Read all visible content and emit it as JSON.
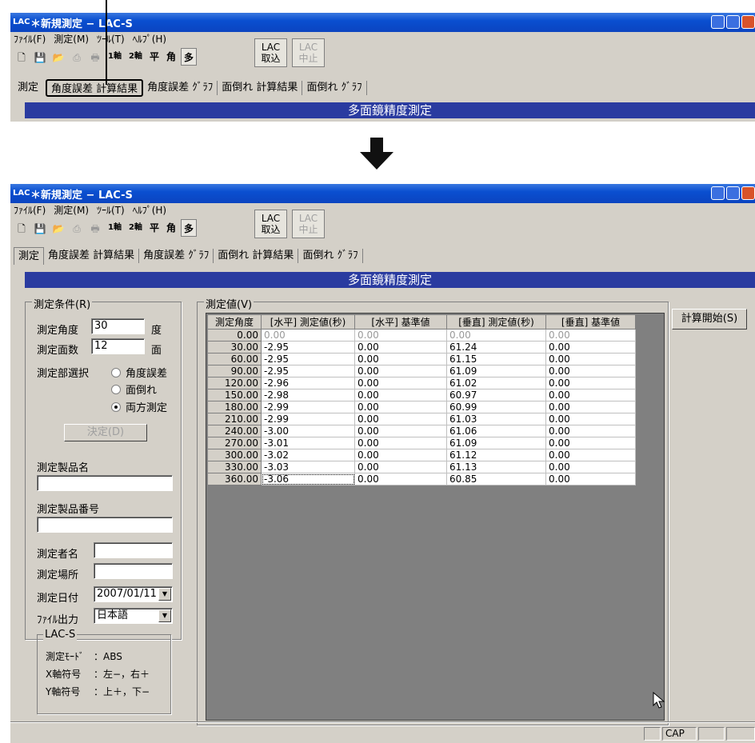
{
  "top_window": {
    "title": "＊新規測定 − LAC-S",
    "menu": [
      "ﾌｧｲﾙ(F)",
      "測定(M)",
      "ﾂｰﾙ(T)",
      "ﾍﾙﾌﾟ(H)"
    ],
    "toolbar": {
      "axis1": "1軸",
      "axis2": "2軸",
      "flat": "平",
      "angle": "角",
      "multi": "多"
    },
    "lac_import": "LAC\n取込",
    "lac_stop": "LAC\n中止",
    "tabs": [
      "測定",
      "角度誤差 計算結果",
      "角度誤差 ｸﾞﾗﾌ",
      "面倒れ 計算結果",
      "面倒れ ｸﾞﾗﾌ"
    ],
    "active_tab_index": 1,
    "banner": "多面鏡精度測定"
  },
  "arrow_icon": "down-arrow",
  "main_window": {
    "title": "＊新規測定 − LAC-S",
    "app_icon": "LAC",
    "menu": [
      "ﾌｧｲﾙ(F)",
      "測定(M)",
      "ﾂｰﾙ(T)",
      "ﾍﾙﾌﾟ(H)"
    ],
    "toolbar": {
      "axis1": "1軸",
      "axis2": "2軸",
      "flat": "平",
      "angle": "角",
      "multi": "多"
    },
    "lac_import": "LAC\n取込",
    "lac_stop": "LAC\n中止",
    "tabs": [
      "測定",
      "角度誤差 計算結果",
      "角度誤差 ｸﾞﾗﾌ",
      "面倒れ 計算結果",
      "面倒れ ｸﾞﾗﾌ"
    ],
    "active_tab_index": 0,
    "banner": "多面鏡精度測定",
    "conditions": {
      "group_label": "測定条件(R)",
      "angle_label": "測定角度",
      "angle_value": "30",
      "angle_unit": "度",
      "faces_label": "測定面数",
      "faces_value": "12",
      "faces_unit": "面",
      "part_label": "測定部選択",
      "radio_options": [
        "角度誤差",
        "面倒れ",
        "両方測定"
      ],
      "selected_radio": 2,
      "decide_button": "決定(D)",
      "product_name_label": "測定製品名",
      "product_name_value": "",
      "product_number_label": "測定製品番号",
      "product_number_value": "",
      "operator_label": "測定者名",
      "operator_value": "",
      "place_label": "測定場所",
      "place_value": "",
      "date_label": "測定日付",
      "date_value": "2007/01/11",
      "file_output_label": "ﾌｧｲﾙ出力",
      "file_output_value": "日本語",
      "lacs": {
        "group_label": "LAC-S",
        "mode_label": "測定ﾓｰﾄﾞ",
        "mode_value": "：ABS",
        "x_label": "X軸符号",
        "x_value": "：左−，右＋",
        "y_label": "Y軸符号",
        "y_value": "：上＋，下−"
      }
    },
    "values": {
      "group_label": "測定値(V)",
      "columns": [
        "測定角度",
        "[水平] 測定値(秒)",
        "[水平] 基準値",
        "[垂直] 測定値(秒)",
        "[垂直] 基準値"
      ],
      "rows": [
        [
          "0.00",
          "0.00",
          "0.00",
          "0.00",
          "0.00"
        ],
        [
          "30.00",
          "-2.95",
          "0.00",
          "61.24",
          "0.00"
        ],
        [
          "60.00",
          "-2.95",
          "0.00",
          "61.15",
          "0.00"
        ],
        [
          "90.00",
          "-2.95",
          "0.00",
          "61.09",
          "0.00"
        ],
        [
          "120.00",
          "-2.96",
          "0.00",
          "61.02",
          "0.00"
        ],
        [
          "150.00",
          "-2.98",
          "0.00",
          "60.97",
          "0.00"
        ],
        [
          "180.00",
          "-2.99",
          "0.00",
          "60.99",
          "0.00"
        ],
        [
          "210.00",
          "-2.99",
          "0.00",
          "61.03",
          "0.00"
        ],
        [
          "240.00",
          "-3.00",
          "0.00",
          "61.06",
          "0.00"
        ],
        [
          "270.00",
          "-3.01",
          "0.00",
          "61.09",
          "0.00"
        ],
        [
          "300.00",
          "-3.02",
          "0.00",
          "61.12",
          "0.00"
        ],
        [
          "330.00",
          "-3.03",
          "0.00",
          "61.13",
          "0.00"
        ],
        [
          "360.00",
          "-3.06",
          "0.00",
          "60.85",
          "0.00"
        ]
      ]
    },
    "calc_button": "計算開始(S)",
    "status": {
      "cap": "CAP"
    }
  }
}
